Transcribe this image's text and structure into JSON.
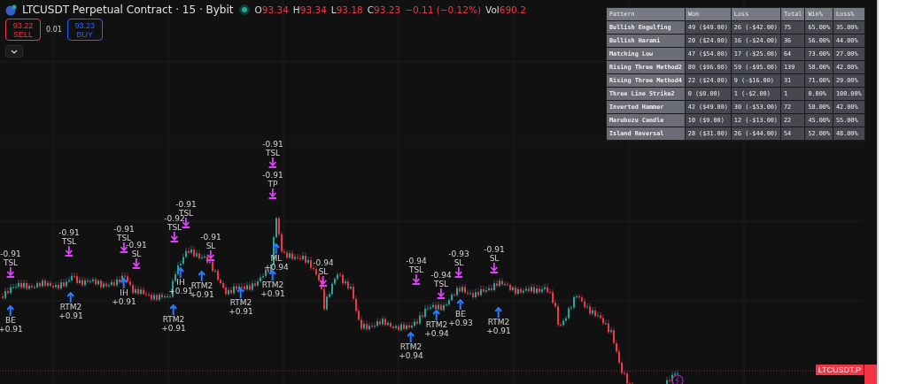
{
  "header": {
    "title": "LTCUSDT Perpetual Contract · 15 · Bybit",
    "ohlc": [
      {
        "key": "O",
        "value": "93.34"
      },
      {
        "key": "H",
        "value": "93.34"
      },
      {
        "key": "L",
        "value": "93.18"
      },
      {
        "key": "C",
        "value": "93.23"
      }
    ],
    "change": "−0.11 (−0.12%)",
    "volume": {
      "key": "Vol",
      "value": "690.2"
    }
  },
  "trade": {
    "sell": {
      "price": "93.22",
      "label": "SELL"
    },
    "spread": "0.01",
    "buy": {
      "price": "93.23",
      "label": "BUY"
    }
  },
  "stats_table": {
    "columns": [
      "Pattern",
      "Won",
      "Loss",
      "Total",
      "Win%",
      "Loss%"
    ],
    "rows": [
      [
        "Bullish Engulfing",
        "49 ($49.00)",
        "26 (-$42.00)",
        "75",
        "65.00%",
        "35.00%"
      ],
      [
        "Bullish Harami",
        "20 ($24.00)",
        "16 (-$24.00)",
        "36",
        "56.00%",
        "44.00%"
      ],
      [
        "Matching Low",
        "47 ($54.00)",
        "17 (-$25.00)",
        "64",
        "73.00%",
        "27.00%"
      ],
      [
        "Rising Three Method2",
        "80 ($96.00)",
        "59 (-$95.00)",
        "139",
        "58.00%",
        "42.00%"
      ],
      [
        "Rising Three Method4",
        "22 ($24.00)",
        "9 (-$16.00)",
        "31",
        "71.00%",
        "29.00%"
      ],
      [
        "Three Line Strike2",
        "0 ($0.00)",
        "1 (-$2.00)",
        "1",
        "0.00%",
        "100.00%"
      ],
      [
        "Inverted Hammer",
        "42 ($49.00)",
        "30 (-$53.00)",
        "72",
        "58.00%",
        "42.00%"
      ],
      [
        "Marubozu Candle",
        "10 ($9.00)",
        "12 (-$13.00)",
        "22",
        "45.00%",
        "55.00%"
      ],
      [
        "Island Reversal",
        "28 ($31.00)",
        "26 (-$44.00)",
        "54",
        "52.00%",
        "48.00%"
      ]
    ]
  },
  "trade_markers": [
    {
      "kind": "exit",
      "lines": [
        "-0.91",
        "TSL"
      ]
    },
    {
      "kind": "exit",
      "lines": [
        "-0.91",
        "TSL"
      ]
    },
    {
      "kind": "exit",
      "lines": [
        "-0.91",
        "TSL"
      ]
    },
    {
      "kind": "exit",
      "lines": [
        "-0.91",
        "SL"
      ]
    },
    {
      "kind": "exit",
      "lines": [
        "-0.92",
        "TSL"
      ]
    },
    {
      "kind": "exit",
      "lines": [
        "-0.91",
        "TSL"
      ]
    },
    {
      "kind": "exit",
      "lines": [
        "-0.91",
        "SL"
      ]
    },
    {
      "kind": "exit",
      "lines": [
        "-0.91",
        "TSL"
      ]
    },
    {
      "kind": "exit",
      "lines": [
        "-0.91",
        "TP"
      ]
    },
    {
      "kind": "exit",
      "lines": [
        "-0.94",
        "SL"
      ]
    },
    {
      "kind": "exit",
      "lines": [
        "-0.94",
        "TSL"
      ]
    },
    {
      "kind": "exit",
      "lines": [
        "-0.94",
        "TSL"
      ]
    },
    {
      "kind": "exit",
      "lines": [
        "-0.93",
        "SL"
      ]
    },
    {
      "kind": "exit",
      "lines": [
        "-0.91",
        "SL"
      ]
    },
    {
      "kind": "entry",
      "lines": [
        "BE",
        "+0.91"
      ]
    },
    {
      "kind": "entry",
      "lines": [
        "RTM2",
        "+0.91"
      ]
    },
    {
      "kind": "entry",
      "lines": [
        "IH",
        "+0.91"
      ]
    },
    {
      "kind": "entry",
      "lines": [
        "RTM2",
        "+0.91"
      ]
    },
    {
      "kind": "entry",
      "lines": [
        "IH",
        "+0.91"
      ]
    },
    {
      "kind": "entry",
      "lines": [
        "RTM2",
        "+0.91"
      ]
    },
    {
      "kind": "entry",
      "lines": [
        "RTM2",
        "+0.91"
      ]
    },
    {
      "kind": "entry",
      "lines": [
        "ML",
        "+0.94"
      ]
    },
    {
      "kind": "entry",
      "lines": [
        "RTM2",
        "+0.91"
      ]
    },
    {
      "kind": "entry",
      "lines": [
        "RTM2",
        "+0.94"
      ]
    },
    {
      "kind": "entry",
      "lines": [
        "RTM2",
        "+0.94"
      ]
    },
    {
      "kind": "entry",
      "lines": [
        "BE",
        "+0.93"
      ]
    },
    {
      "kind": "entry",
      "lines": [
        "RTM2",
        "+0.91"
      ]
    }
  ],
  "price_tag": "LTCUSDT.P"
}
